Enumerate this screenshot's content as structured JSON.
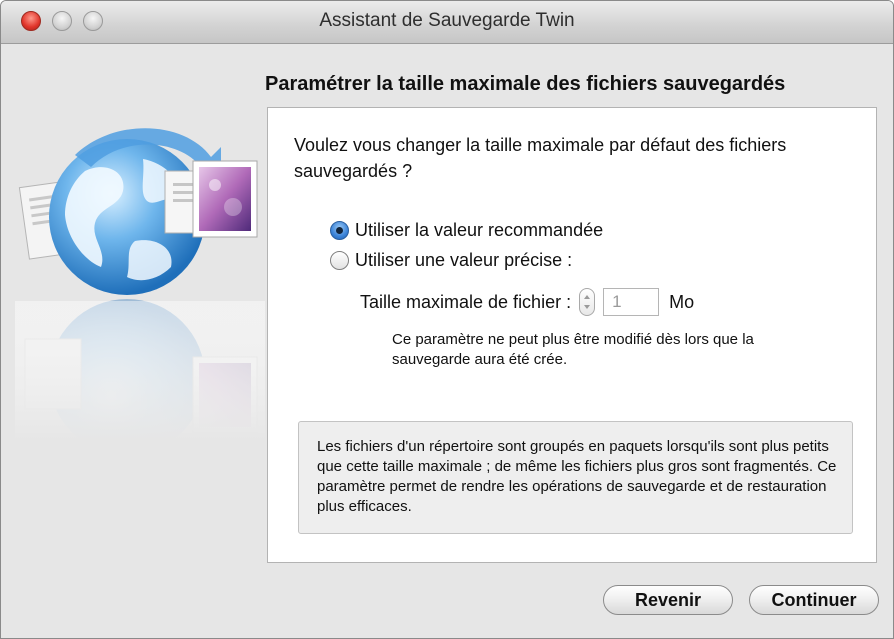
{
  "window": {
    "title": "Assistant de Sauvegarde Twin",
    "controls": [
      "close",
      "minimize",
      "zoom"
    ],
    "colors": {
      "close": "#e0342a",
      "selected_radio": "#3b83d8"
    }
  },
  "illustration": {
    "icon": "globe-with-files-icon"
  },
  "heading": "Paramétrer la taille maximale des fichiers sauvegardés",
  "question": "Voulez vous changer la taille maximale par défaut des fichiers sauvegardés ?",
  "options": [
    {
      "label": "Utiliser la valeur recommandée",
      "selected": true
    },
    {
      "label": "Utiliser une valeur précise :",
      "selected": false
    }
  ],
  "size_field": {
    "label": "Taille maximale de fichier :",
    "value": "1",
    "unit": "Mo",
    "enabled": false
  },
  "note": "Ce paramètre ne peut plus être modifié dès lors que la sauvegarde aura été crée.",
  "info": "Les fichiers d'un répertoire sont groupés en paquets lorsqu'ils sont plus petits que cette taille maximale ; de même les fichiers plus gros sont fragmentés. Ce paramètre permet de rendre les opérations de sauvegarde et de restauration plus efficaces.",
  "buttons": {
    "back": "Revenir",
    "next": "Continuer"
  }
}
